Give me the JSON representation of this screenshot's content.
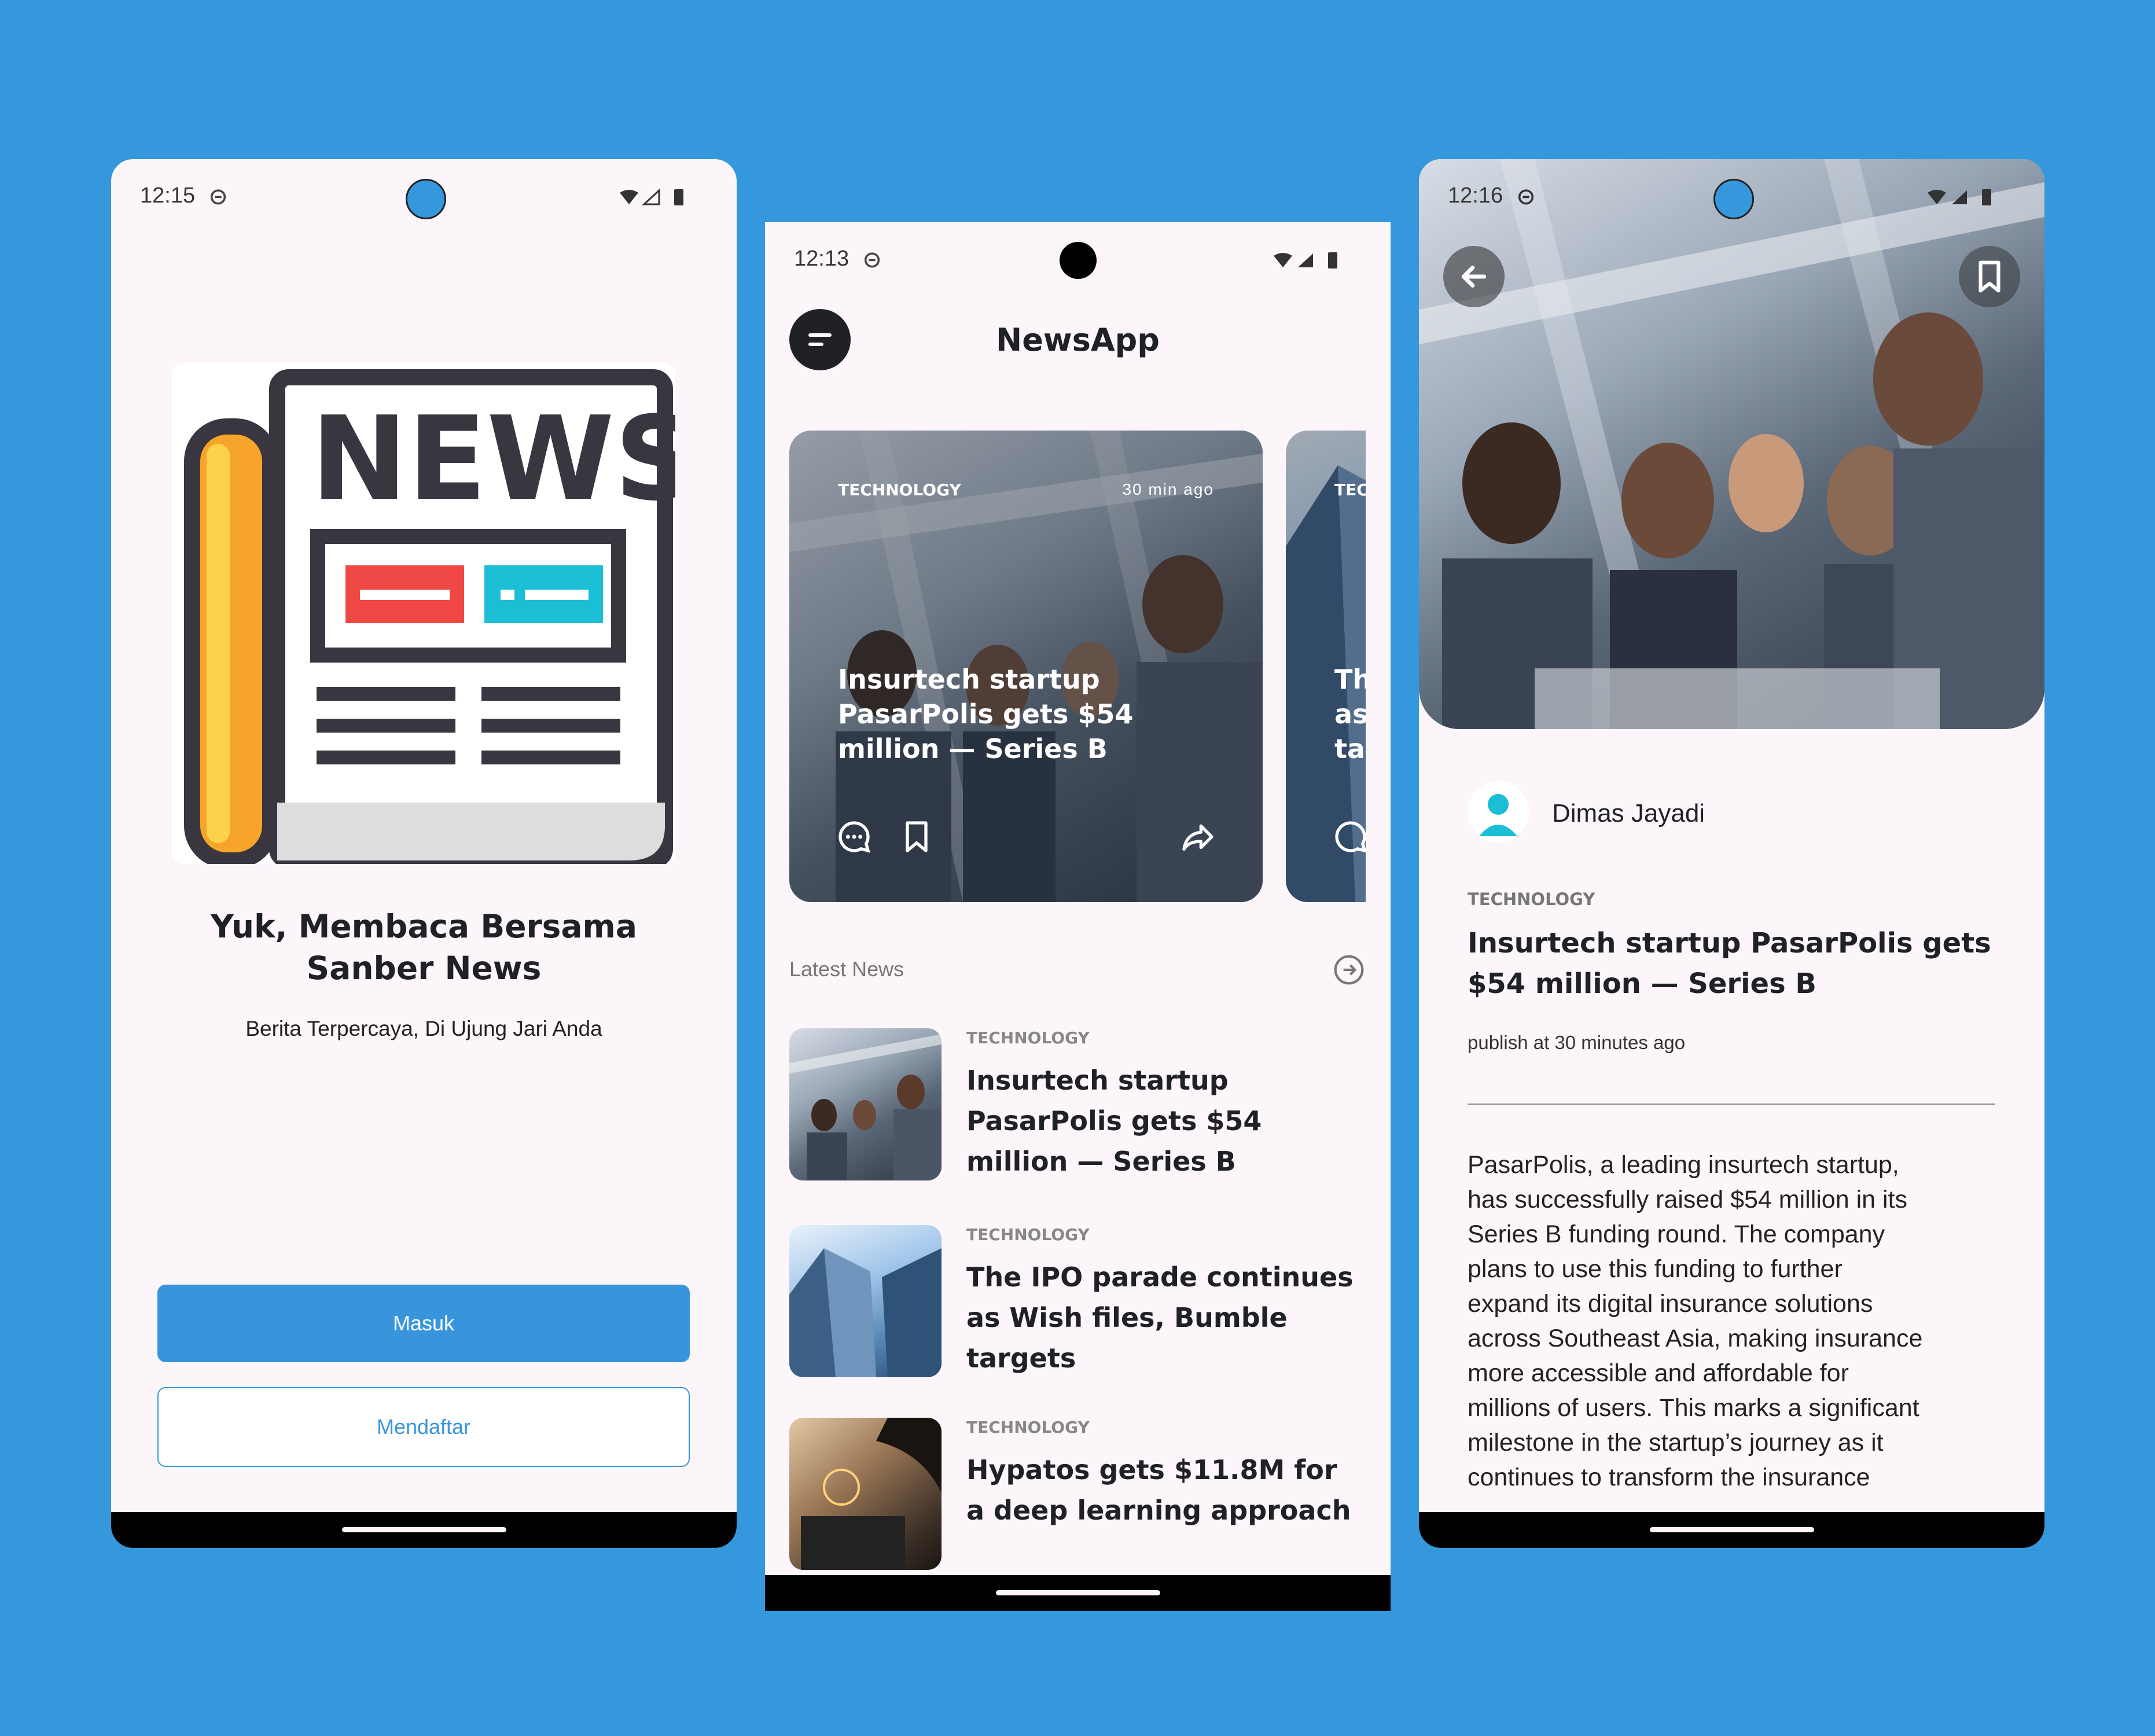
{
  "colors": {
    "background": "#3597dc",
    "phone_bg": "#fcf6fb",
    "primary": "#3895db",
    "dark": "#202124",
    "accent_teal": "#1bbed4",
    "camera": "#3597dc"
  },
  "screen_welcome": {
    "status_time": "12:15",
    "logo_word": "NEWS",
    "title": "Yuk, Membaca Bersama Sanber News",
    "subtitle": "Berita Terpercaya, Di Ujung Jari Anda",
    "login_button": "Masuk",
    "register_button": "Mendaftar"
  },
  "screen_home": {
    "status_time": "12:13",
    "app_title": "NewsApp",
    "menu_icon": "menu-icon",
    "featured": [
      {
        "category": "TECHNOLOGY",
        "time": "30 min ago",
        "title": "Insurtech startup PasarPolis gets $54 million — Series B",
        "icons": [
          "comment-icon",
          "bookmark-icon",
          "share-icon"
        ]
      },
      {
        "category": "TEC",
        "title_lines": [
          "Th",
          "as",
          "ta"
        ]
      }
    ],
    "latest_label": "Latest News",
    "latest_icon": "arrow-right-circle-icon",
    "latest": [
      {
        "category": "TECHNOLOGY",
        "title": "Insurtech startup PasarPolis gets $54 million — Series B"
      },
      {
        "category": "TECHNOLOGY",
        "title": "The IPO parade continues as Wish files, Bumble targets"
      },
      {
        "category": "TECHNOLOGY",
        "title": "Hypatos gets $11.8M for a deep learning approach"
      }
    ]
  },
  "screen_detail": {
    "status_time": "12:16",
    "back_icon": "arrow-left-icon",
    "bookmark_icon": "bookmark-icon",
    "author": "Dimas Jayadi",
    "category": "TECHNOLOGY",
    "title": "Insurtech startup PasarPolis gets $54 million — Series B",
    "published": "publish at 30 minutes ago",
    "body_lines": [
      "PasarPolis, a leading insurtech startup,",
      "has successfully raised $54 million in its",
      "Series B funding round. The company",
      "plans to use this funding to further",
      "expand its digital insurance solutions",
      "across Southeast Asia, making insurance",
      "more accessible and affordable for",
      "millions of users. This marks a significant",
      "milestone in the startup’s journey as it",
      "continues to transform the insurance"
    ]
  }
}
